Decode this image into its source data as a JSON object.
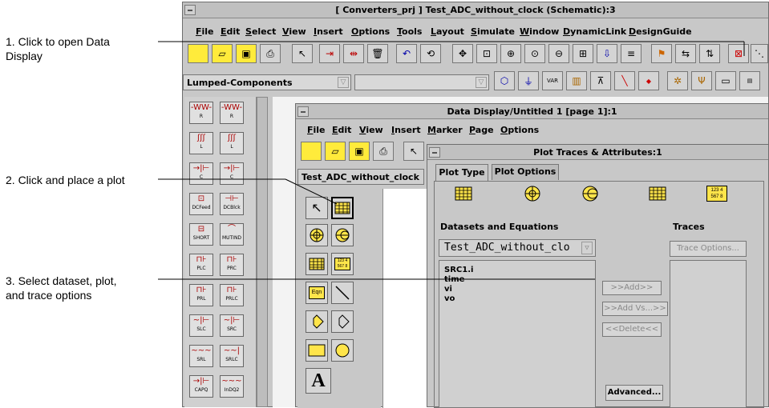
{
  "annotations": {
    "a1_line1": "1. Click to open Data",
    "a1_line2": "Display",
    "a2": "2. Click and place a plot",
    "a3_line1": "3. Select dataset, plot,",
    "a3_line2": "and trace options"
  },
  "main_window": {
    "title": "[ Converters_prj ] Test_ADC_without_clock (Schematic):3",
    "menu": [
      "File",
      "Edit",
      "Select",
      "View",
      "Insert",
      "Options",
      "Tools",
      "Layout",
      "Simulate",
      "Window",
      "DynamicLink",
      "DesignGuide"
    ],
    "palette_combo": "Lumped-Components",
    "palette_items": [
      {
        "sym": "-WW-",
        "label": "R"
      },
      {
        "sym": "-WW-",
        "label": "R"
      },
      {
        "sym": "ʃʃʃ",
        "label": "L"
      },
      {
        "sym": "ʃʃʃ",
        "label": "L"
      },
      {
        "sym": "→|⊢",
        "label": "C"
      },
      {
        "sym": "→|⊢",
        "label": "C"
      },
      {
        "sym": "⊡",
        "label": "DCFeed"
      },
      {
        "sym": "⊣⊢",
        "label": "DCBlck"
      },
      {
        "sym": "⊟",
        "label": "SHORT"
      },
      {
        "sym": "⌒",
        "label": "MUTIND"
      },
      {
        "sym": "⊓⊦",
        "label": "PLC"
      },
      {
        "sym": "⊓⊦",
        "label": "PRC"
      },
      {
        "sym": "⊓⊦",
        "label": "PRL"
      },
      {
        "sym": "⊓⊦",
        "label": "PRLC"
      },
      {
        "sym": "~|⊢",
        "label": "SLC"
      },
      {
        "sym": "~|⊢",
        "label": "SRC"
      },
      {
        "sym": "~~~",
        "label": "SRL"
      },
      {
        "sym": "~~|",
        "label": "SRLC"
      },
      {
        "sym": "→|⊢",
        "label": "CAPQ"
      },
      {
        "sym": "~~~",
        "label": "InDQ2"
      }
    ]
  },
  "data_display": {
    "title": "Data Display/Untitled 1 [page 1]:1",
    "menu": [
      "File",
      "Edit",
      "View",
      "Insert",
      "Marker",
      "Page",
      "Options"
    ],
    "dataset_combo": "Test_ADC_without_clock"
  },
  "plot_traces": {
    "title": "Plot Traces & Attributes:1",
    "tabs": [
      "Plot Type",
      "Plot Options"
    ],
    "datasets_label": "Datasets and Equations",
    "traces_label": "Traces",
    "dataset_select": "Test_ADC_without_clo",
    "trace_options": "Trace Options...",
    "variables": [
      "SRC1.i",
      "time",
      "vi",
      "vo"
    ],
    "add_btn": ">>Add>>",
    "add_vs_btn": ">>Add Vs...>>",
    "delete_btn": "<<Delete<<",
    "advanced_btn": "Advanced..."
  },
  "icons": {
    "eqn_label": "Eqn",
    "text_tool": "A",
    "list_icon_text": "123 4\n567 8"
  }
}
